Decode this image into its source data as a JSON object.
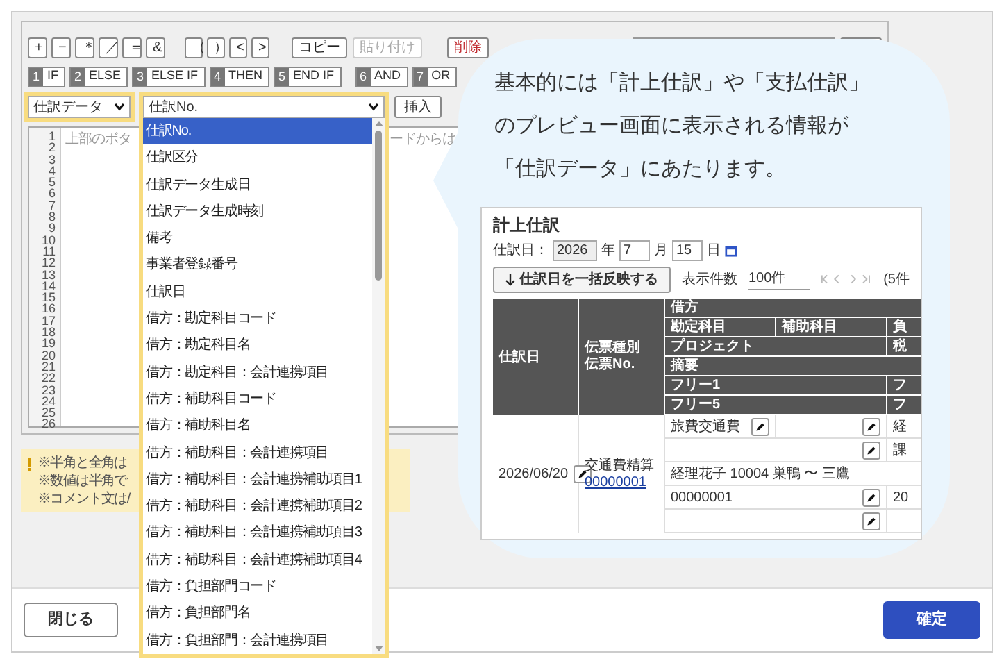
{
  "toolbar": {
    "operators": [
      "+",
      "−",
      "＊",
      "／",
      "＝",
      "&"
    ],
    "brackets": [
      "（",
      "）",
      "<",
      ">"
    ],
    "edit_buttons": [
      {
        "label": "コピー",
        "disabled": false,
        "kind": "normal"
      },
      {
        "label": "貼り付け",
        "disabled": true,
        "kind": "normal"
      },
      {
        "label": "削除",
        "disabled": false,
        "kind": "danger"
      }
    ]
  },
  "control_buttons": [
    {
      "number": "1",
      "label": "IF"
    },
    {
      "number": "2",
      "label": "ELSE"
    },
    {
      "number": "3",
      "label": "ELSE IF"
    },
    {
      "number": "4",
      "label": "THEN"
    },
    {
      "number": "5",
      "label": "END IF"
    }
  ],
  "logic_buttons": [
    {
      "number": "6",
      "label": "AND"
    },
    {
      "number": "7",
      "label": "OR"
    }
  ],
  "category_select": {
    "value": "仕訳データ",
    "highlighted": true
  },
  "field_select": {
    "value": "仕訳No.",
    "highlighted": true,
    "expanded": true
  },
  "insert_button": "挿入",
  "editor": {
    "line_numbers": [
      "1",
      "2",
      "3",
      "4",
      "5",
      "6",
      "7",
      "8",
      "9",
      "10",
      "11",
      "12",
      "13",
      "14",
      "15",
      "16",
      "17",
      "18",
      "19",
      "20",
      "21",
      "22",
      "23",
      "24",
      "25",
      "26"
    ],
    "placeholder_parts": [
      "上部のボタ",
      "ードからは"
    ]
  },
  "notes": [
    "※半角と全角は",
    "※数値は半角で",
    "※コメント文は/"
  ],
  "dropdown_options": [
    {
      "label": "仕訳No.",
      "selected": true
    },
    {
      "label": "仕訳区分",
      "selected": false
    },
    {
      "label": "仕訳データ生成日",
      "selected": false
    },
    {
      "label": "仕訳データ生成時刻",
      "selected": false
    },
    {
      "label": "備考",
      "selected": false
    },
    {
      "label": "事業者登録番号",
      "selected": false
    },
    {
      "label": "仕訳日",
      "selected": false
    },
    {
      "label": "借方：勘定科目コード",
      "selected": false
    },
    {
      "label": "借方：勘定科目名",
      "selected": false
    },
    {
      "label": "借方：勘定科目：会計連携項目",
      "selected": false
    },
    {
      "label": "借方：補助科目コード",
      "selected": false
    },
    {
      "label": "借方：補助科目名",
      "selected": false
    },
    {
      "label": "借方：補助科目：会計連携項目",
      "selected": false
    },
    {
      "label": "借方：補助科目：会計連携補助項目1",
      "selected": false
    },
    {
      "label": "借方：補助科目：会計連携補助項目2",
      "selected": false
    },
    {
      "label": "借方：補助科目：会計連携補助項目3",
      "selected": false
    },
    {
      "label": "借方：補助科目：会計連携補助項目4",
      "selected": false
    },
    {
      "label": "借方：負担部門コード",
      "selected": false
    },
    {
      "label": "借方：負担部門名",
      "selected": false
    },
    {
      "label": "借方：負担部門：会計連携項目",
      "selected": false
    }
  ],
  "callout": {
    "lines": [
      "基本的には「計上仕訳」や「支払仕訳」",
      "のプレビュー画面に表示される情報が",
      "「仕訳データ」にあたります。"
    ],
    "preview": {
      "title": "計上仕訳",
      "date_label": "仕訳日：",
      "year": "2026",
      "year_unit": "年",
      "month": "7",
      "month_unit": "月",
      "day": "15",
      "day_unit": "日",
      "apply_button": "仕訳日を一括反映する",
      "count_label": "表示件数",
      "count_value": "100件",
      "pager_text": "(5件",
      "header": {
        "date": "仕訳日",
        "slip": [
          "伝票種別",
          "伝票No."
        ],
        "debit": "借方",
        "rows": [
          [
            "勘定科目",
            "補助科目",
            "負"
          ],
          [
            "プロジェクト",
            "税"
          ],
          [
            "摘要"
          ],
          [
            "フリー1",
            "フ"
          ],
          [
            "フリー5",
            "フ"
          ]
        ]
      },
      "row": {
        "date": "2026/06/20",
        "slip_type": "交通費精算",
        "slip_no": "00000001",
        "lines": [
          {
            "cells": [
              {
                "text": "旅費交通費",
                "has_edit": true
              },
              {
                "text": "",
                "has_edit": true
              },
              {
                "text": "経",
                "has_edit": false
              }
            ]
          },
          {
            "cells": [
              {
                "text": "",
                "has_edit": true
              },
              {
                "text": "課",
                "has_edit": false
              }
            ]
          },
          {
            "cells": [
              {
                "text": "経理花子 10004 巣鴨 〜 三鷹",
                "has_edit": false
              }
            ]
          },
          {
            "cells": [
              {
                "text": "00000001",
                "has_edit": true
              },
              {
                "text": "20",
                "has_edit": false
              }
            ]
          },
          {
            "cells": [
              {
                "text": "",
                "has_edit": true
              },
              {
                "text": "",
                "has_edit": false
              }
            ]
          }
        ]
      }
    }
  },
  "footer": {
    "close_button": "閉じる",
    "confirm_button": "確定"
  }
}
